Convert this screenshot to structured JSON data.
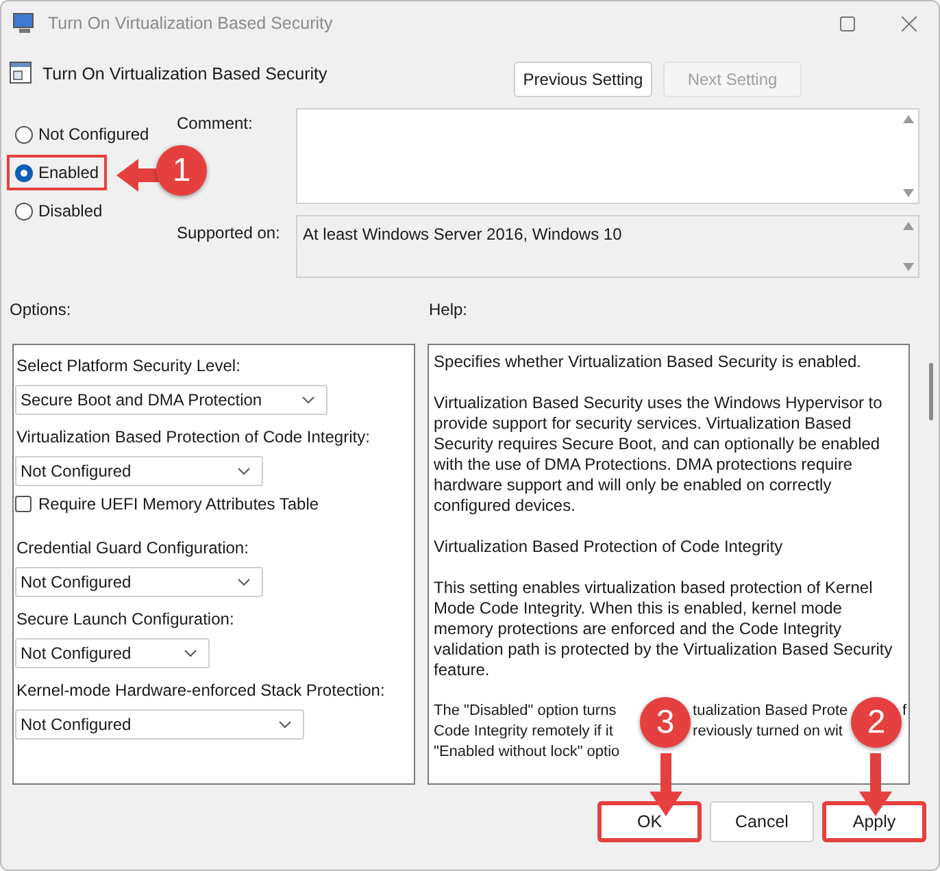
{
  "window": {
    "title": "Turn On Virtualization Based Security"
  },
  "policy_title": "Turn On Virtualization Based Security",
  "nav_buttons": [
    {
      "label": "Previous Setting",
      "disabled": false
    },
    {
      "label": "Next Setting",
      "disabled": true
    }
  ],
  "state_options": [
    {
      "label": "Not Configured",
      "selected": false,
      "highlighted": false
    },
    {
      "label": "Enabled",
      "selected": true,
      "highlighted": true
    },
    {
      "label": "Disabled",
      "selected": false,
      "highlighted": false
    }
  ],
  "comment": {
    "label": "Comment:"
  },
  "supported_on": {
    "label": "Supported on:",
    "value": "At least Windows Server 2016, Windows 10"
  },
  "options": {
    "label": "Options:",
    "items": [
      {
        "kind": "dropdown",
        "label": "Select Platform Security Level:",
        "value": "Secure Boot and DMA Protection"
      },
      {
        "kind": "dropdown",
        "label": "Virtualization Based Protection of Code Integrity:",
        "value": "Not Configured"
      },
      {
        "kind": "checkbox",
        "label": "Require UEFI Memory Attributes Table",
        "checked": false
      },
      {
        "kind": "dropdown",
        "label": "Credential Guard Configuration:",
        "value": "Not Configured"
      },
      {
        "kind": "dropdown",
        "label": "Secure Launch Configuration:",
        "value": "Not Configured"
      },
      {
        "kind": "dropdown",
        "label": "Kernel-mode Hardware-enforced Stack Protection:",
        "value": "Not Configured"
      }
    ]
  },
  "help": {
    "label": "Help:",
    "paragraphs": [
      "Specifies whether Virtualization Based Security is enabled.",
      "Virtualization Based Security uses the Windows Hypervisor to provide support for security services. Virtualization Based Security requires Secure Boot, and can optionally be enabled with the use of DMA Protections. DMA protections require hardware support and will only be enabled on correctly configured devices.",
      "Virtualization Based Protection of Code Integrity",
      "This setting enables virtualization based protection of Kernel Mode Code Integrity. When this is enabled, kernel mode memory protections are enforced and the Code Integrity validation path is protected by the Virtualization Based Security feature."
    ],
    "covered_lines": [
      [
        "The \"Disabled\" option turns",
        "tualization Based Prote",
        "f"
      ],
      [
        "Code Integrity remotely if it",
        "reviously turned on wit"
      ],
      [
        "\"Enabled without lock\" optio"
      ]
    ]
  },
  "buttons": [
    {
      "label": "OK",
      "highlighted": true
    },
    {
      "label": "Cancel",
      "highlighted": false
    },
    {
      "label": "Apply",
      "highlighted": true
    }
  ],
  "callouts": [
    {
      "number": "1"
    },
    {
      "number": "2"
    },
    {
      "number": "3"
    }
  ]
}
